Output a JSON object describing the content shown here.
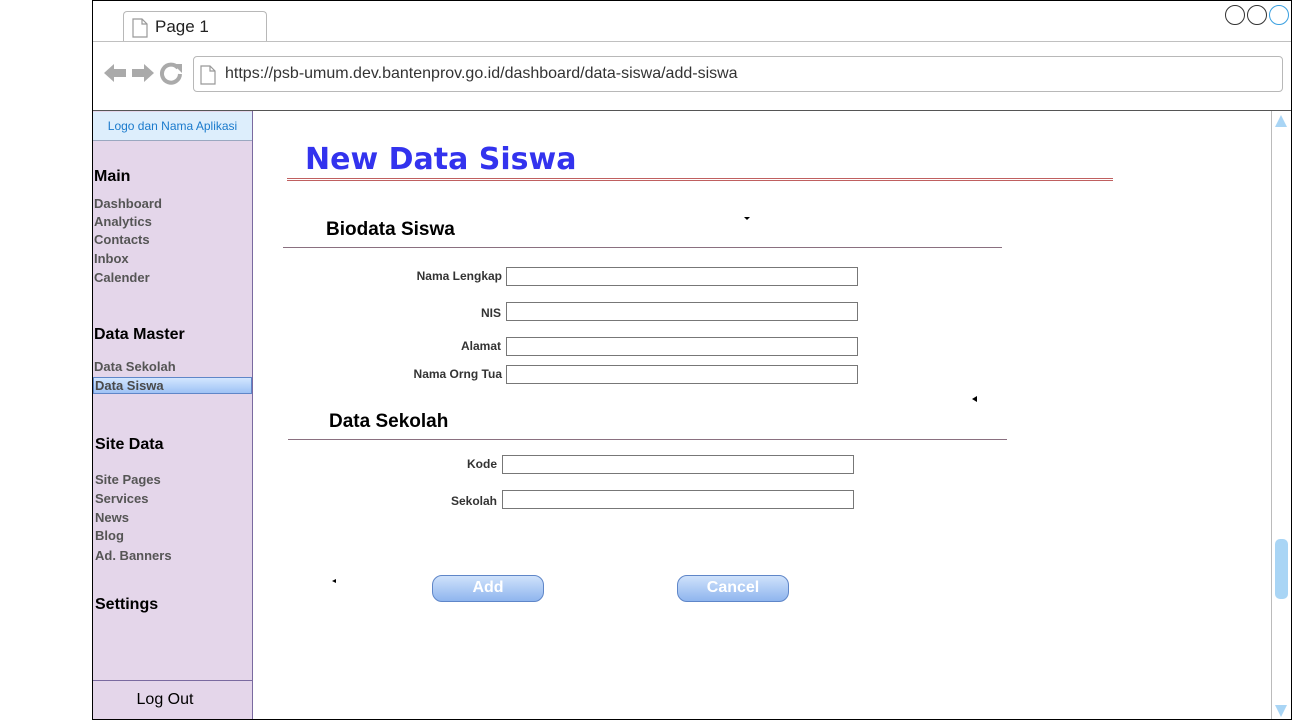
{
  "browser": {
    "tab_label": "Page 1",
    "url": "https://psb-umum.dev.bantenprov.go.id/dashboard/data-siswa/add-siswa"
  },
  "sidebar": {
    "logo": "Logo dan Nama Aplikasi",
    "sections": [
      {
        "heading": "Main",
        "items": [
          "Dashboard",
          "Analytics",
          "Contacts",
          "Inbox",
          "Calender"
        ]
      },
      {
        "heading": "Data Master",
        "items": [
          "Data Sekolah",
          "Data Siswa"
        ]
      },
      {
        "heading": "Site Data",
        "items": [
          "Site Pages",
          "Services",
          "News",
          "Blog",
          "Ad. Banners"
        ]
      },
      {
        "heading": "Settings",
        "items": []
      }
    ],
    "active_item": "Data Siswa",
    "logout": "Log Out"
  },
  "content": {
    "page_title": "New Data Siswa",
    "biodata": {
      "title": "Biodata Siswa",
      "fields": [
        {
          "label": "Nama Lengkap",
          "value": ""
        },
        {
          "label": "NIS",
          "value": ""
        },
        {
          "label": "Alamat",
          "value": ""
        },
        {
          "label": "Nama Orng Tua",
          "value": ""
        }
      ]
    },
    "sekolah": {
      "title": "Data Sekolah",
      "fields": [
        {
          "label": "Kode",
          "value": ""
        },
        {
          "label": "Sekolah",
          "value": ""
        }
      ]
    },
    "buttons": {
      "add": "Add",
      "cancel": "Cancel"
    }
  }
}
